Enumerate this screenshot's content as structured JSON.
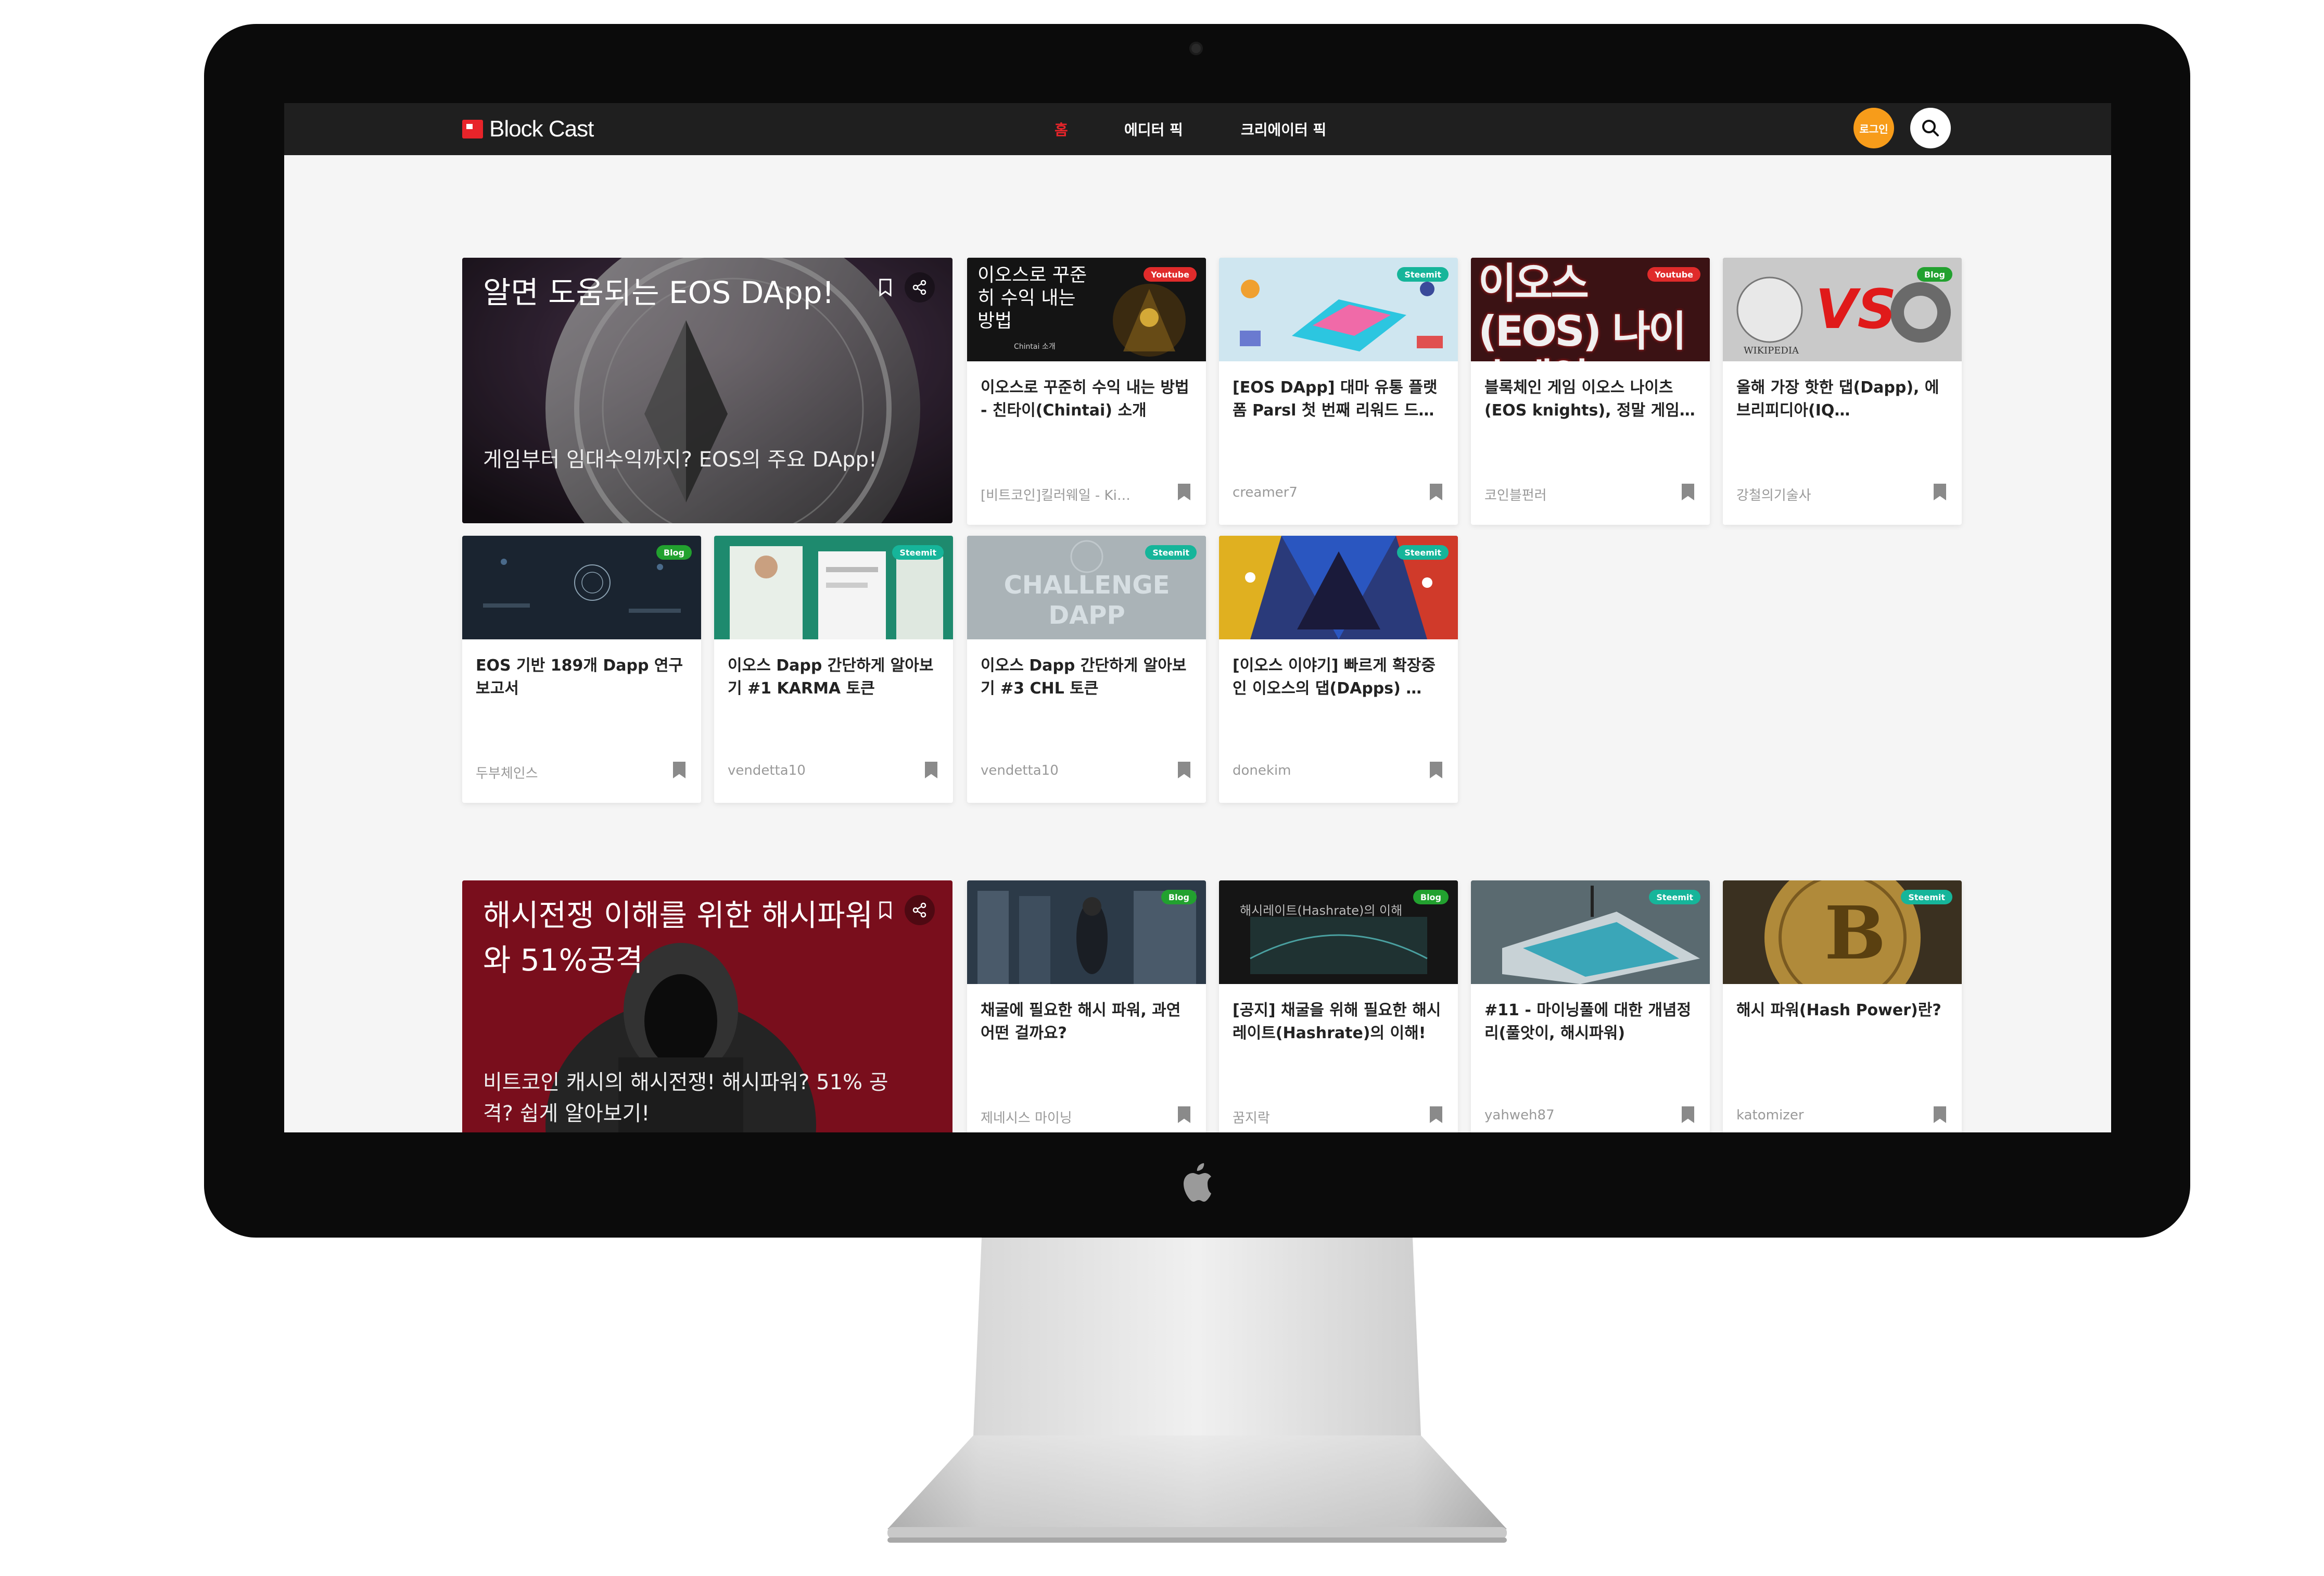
{
  "header": {
    "logo": "Block Cast",
    "nav": {
      "home": "홈",
      "editor": "에디터 픽",
      "creator": "크리에이터 픽"
    },
    "login": "로그인"
  },
  "section1": {
    "feature": {
      "title": "알면 도움되는 EOS DApp!",
      "subtitle": "게임부터 임대수익까지? EOS의 주요 DApp!"
    },
    "cards": [
      {
        "badge": "Youtube",
        "thumb_text": "이오스로 꾸준히 수익 내는 방법",
        "thumb_caption": "Chintai 소개",
        "title": "이오스로 꾸준히 수익 내는 방법 - 친타이(Chintai) 소개",
        "author": "[비트코인]킬러웨일 - Ki…"
      },
      {
        "badge": "Steemit",
        "title": "[EOS DApp] 대마 유통 플랫폼 Parsl 첫 번째 리워드 드…",
        "author": "creamer7"
      },
      {
        "badge": "Youtube",
        "thumb_text": "이오스(EOS) 나이츠게임",
        "title": "블록체인 게임 이오스 나이츠(EOS knights), 정말 게임…",
        "author": "코인블펀러"
      },
      {
        "badge": "Blog",
        "thumb_text": "VS",
        "thumb_caption": "WIKIPEDIA",
        "title": "올해 가장 핫한 댑(Dapp), 에브리피디아(IQ…",
        "author": "강철의기술사"
      },
      {
        "badge": "Blog",
        "title": "EOS 기반 189개 Dapp 연구보고서",
        "author": "두부체인스"
      },
      {
        "badge": "Steemit",
        "title": "이오스 Dapp 간단하게 알아보기 #1 KARMA 토큰",
        "author": "vendetta10"
      },
      {
        "badge": "Steemit",
        "thumb_text": "CHALLENGE DAPP",
        "title": "이오스 Dapp 간단하게 알아보기 #3 CHL 토큰",
        "author": "vendetta10"
      },
      {
        "badge": "Steemit",
        "title": "[이오스 이야기] 빠르게 확장중인 이오스의 댑(DApps) …",
        "author": "donekim"
      }
    ]
  },
  "section2": {
    "feature": {
      "title": "해시전쟁 이해를 위한 해시파워와 51%공격",
      "subtitle": "비트코인 캐시의 해시전쟁! 해시파워? 51% 공격? 쉽게 알아보기!"
    },
    "cards": [
      {
        "badge": "Blog",
        "title": "채굴에 필요한 해시 파워, 과연 어떤 걸까요?",
        "author": "제네시스 마이닝"
      },
      {
        "badge": "Blog",
        "thumb_text": "해시레이트(Hashrate)의 이해",
        "title": "[공지] 채굴을 위해 필요한 해시레이트(Hashrate)의 이해!",
        "author": "꿈지락"
      },
      {
        "badge": "Steemit",
        "title": "#11 - 마이닝풀에 대한 개념정리(풀앗이, 해시파워)",
        "author": "yahweh87"
      },
      {
        "badge": "Steemit",
        "title": "해시 파워(Hash Power)란?",
        "author": "katomizer"
      }
    ]
  },
  "colors": {
    "accent": "#e8242a",
    "login": "#f79c1a",
    "youtube": "#e02b2b",
    "steemit": "#16b59a",
    "blog": "#22a12f"
  },
  "icons": [
    "bookmark-icon",
    "share-icon",
    "search-icon",
    "apple-logo-icon"
  ]
}
